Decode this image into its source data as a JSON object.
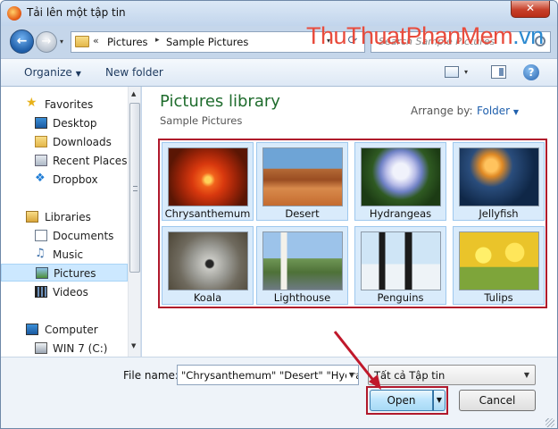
{
  "window": {
    "title": "Tải lên một tập tin",
    "close_label": "✕"
  },
  "nav": {
    "back_icon": "back-arrow-icon",
    "forward_icon": "forward-arrow-icon"
  },
  "address": {
    "chevron": "«",
    "crumbs": [
      "Pictures",
      "Sample Pictures"
    ],
    "separator": "▸",
    "refresh": "⟳"
  },
  "search": {
    "placeholder": "Search Sample Pictures"
  },
  "watermark": {
    "part1": "ThuThuat",
    "part2": "PhanMem",
    "part3": ".vn"
  },
  "toolbar": {
    "organize": "Organize",
    "new_folder": "New folder",
    "help": "?"
  },
  "sidebar": {
    "favorites_label": "Favorites",
    "favorites": [
      "Desktop",
      "Downloads",
      "Recent Places",
      "Dropbox"
    ],
    "libraries_label": "Libraries",
    "libraries": [
      "Documents",
      "Music",
      "Pictures",
      "Videos"
    ],
    "computer_label": "Computer",
    "drives": [
      "WIN 7 (C:)"
    ],
    "selected": "Pictures"
  },
  "content": {
    "title": "Pictures library",
    "subtitle": "Sample Pictures",
    "arrange_label": "Arrange by:",
    "arrange_value": "Folder",
    "items": [
      "Chrysanthemum",
      "Desert",
      "Hydrangeas",
      "Jellyfish",
      "Koala",
      "Lighthouse",
      "Penguins",
      "Tulips"
    ]
  },
  "footer": {
    "filename_label": "File name:",
    "filename_value": "\"Chrysanthemum\" \"Desert\" \"Hydrangeas\" \"Jellyfish\"",
    "filter_value": "Tất cả Tập tin",
    "open_label": "Open",
    "cancel_label": "Cancel"
  },
  "colors": {
    "highlight_border": "#b0182b",
    "library_title": "#1f6c2d",
    "selection": "#cce8ff"
  }
}
